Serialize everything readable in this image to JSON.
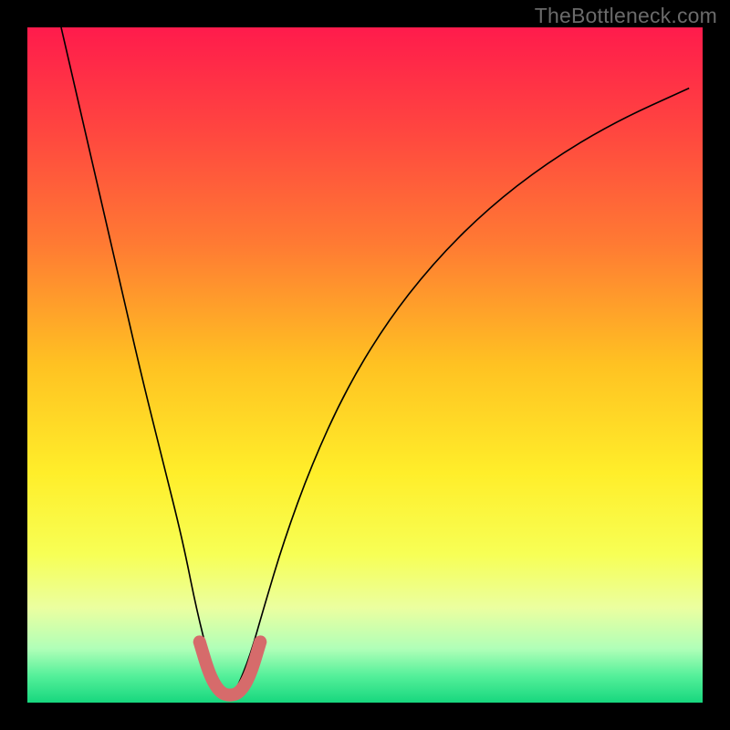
{
  "watermark": "TheBottleneck.com",
  "chart_data": {
    "type": "line",
    "title": "",
    "xlabel": "",
    "ylabel": "",
    "xlim": [
      0,
      100
    ],
    "ylim": [
      0,
      100
    ],
    "grid": false,
    "legend": false,
    "series": [
      {
        "name": "bottleneck-curve",
        "x": [
          5,
          8,
          11,
          14,
          17,
          20,
          23,
          25,
          27,
          29,
          30,
          31,
          33,
          35,
          38,
          42,
          47,
          53,
          60,
          68,
          77,
          87,
          98
        ],
        "y": [
          100,
          87,
          74,
          61,
          48,
          36,
          24,
          14,
          6,
          2,
          1,
          2,
          7,
          14,
          24,
          35,
          46,
          56,
          65,
          73,
          80,
          86,
          91
        ],
        "color": "#000000",
        "stroke_width": 1.6
      },
      {
        "name": "optimal-zone",
        "x": [
          25.5,
          27,
          28.5,
          30,
          31.5,
          33,
          34.5
        ],
        "y": [
          9,
          4,
          1.5,
          1,
          1.5,
          4,
          9
        ],
        "color": "#d66b6b",
        "stroke_width": 14
      }
    ],
    "background_gradient": {
      "stops": [
        {
          "offset": 0.0,
          "color": "#ff1b4c"
        },
        {
          "offset": 0.15,
          "color": "#ff4540"
        },
        {
          "offset": 0.32,
          "color": "#ff7a33"
        },
        {
          "offset": 0.5,
          "color": "#ffc222"
        },
        {
          "offset": 0.66,
          "color": "#ffee2a"
        },
        {
          "offset": 0.78,
          "color": "#f7ff55"
        },
        {
          "offset": 0.86,
          "color": "#ebffa0"
        },
        {
          "offset": 0.92,
          "color": "#b0ffb8"
        },
        {
          "offset": 0.96,
          "color": "#55f09a"
        },
        {
          "offset": 1.0,
          "color": "#17d77e"
        }
      ]
    }
  }
}
